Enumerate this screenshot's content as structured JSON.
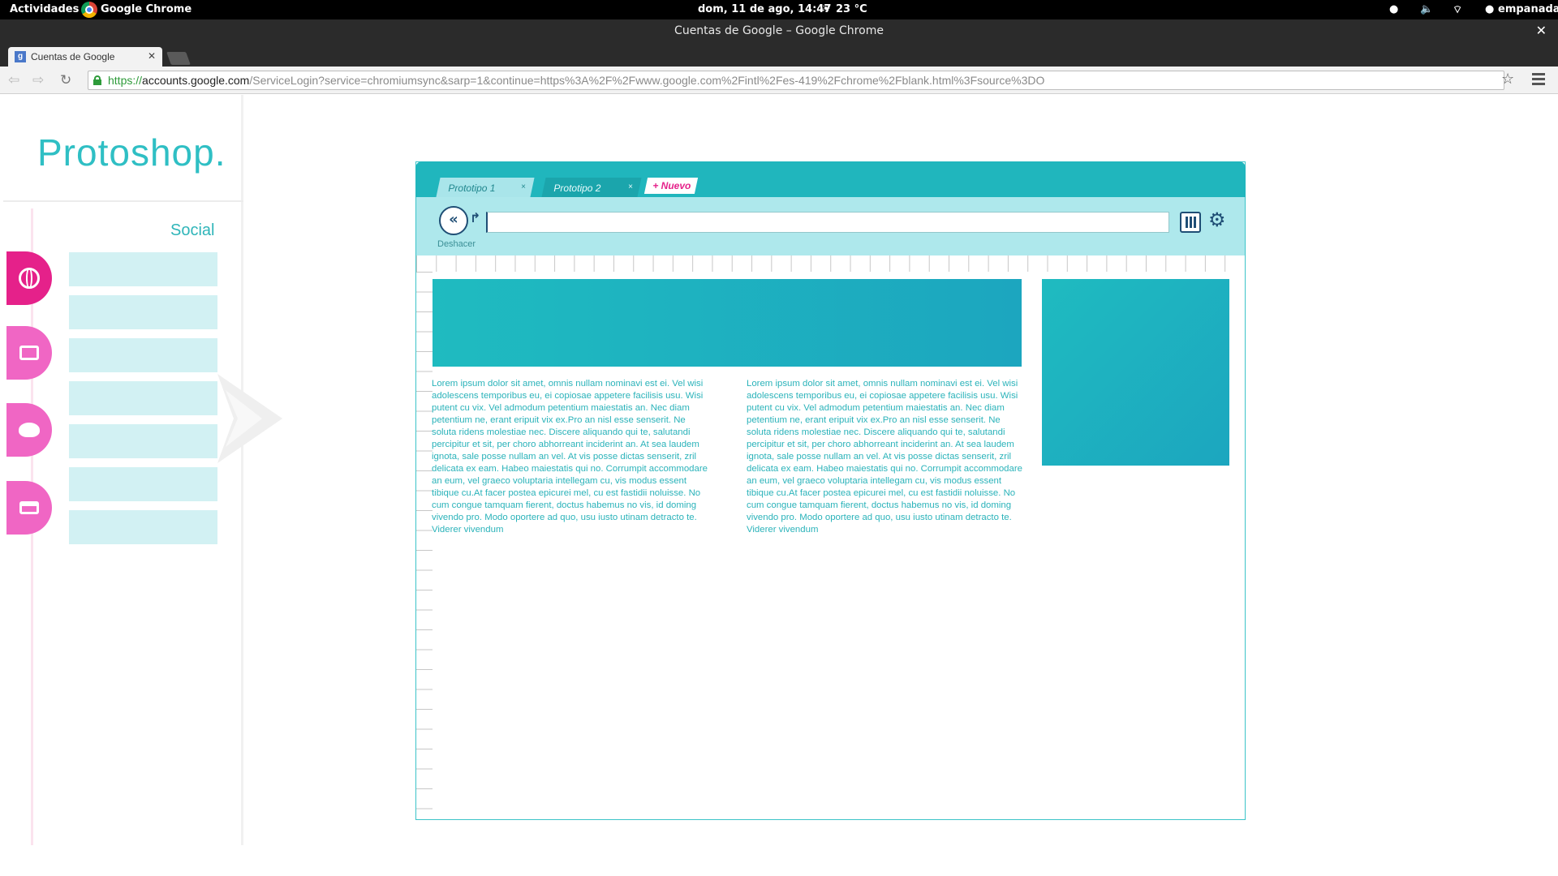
{
  "topbar": {
    "activities": "Actividades",
    "app_name": "Google Chrome",
    "clock": "dom, 11 de ago, 14:47",
    "weather": "23 °C",
    "user": "empanada"
  },
  "window": {
    "title": "Cuentas de Google – Google Chrome"
  },
  "browser": {
    "tab_title": "Cuentas de Google",
    "url_scheme": "https://",
    "url_domain": "accounts.google.com",
    "url_path": "/ServiceLogin?service=chromiumsync&sarp=1&continue=https%3A%2F%2Fwww.google.com%2Fintl%2Fes-419%2Fchrome%2Fblank.html%3Fsource%3DO"
  },
  "sidebar": {
    "brand": "Protoshop.",
    "section": "Social",
    "categories": [
      {
        "name": "globe-icon",
        "color": "#e5218a"
      },
      {
        "name": "photos-icon",
        "color": "#f066c4"
      },
      {
        "name": "palette-icon",
        "color": "#f066c4"
      },
      {
        "name": "card-icon",
        "color": "#f066c4"
      }
    ]
  },
  "app": {
    "tabs": [
      {
        "label": "Prototipo 1",
        "active": true
      },
      {
        "label": "Prototipo 2",
        "active": false
      }
    ],
    "new_tab": "+ Nuevo",
    "undo_label": "Deshacer",
    "colors": {
      "accent": "#20b6bd",
      "bar": "#aee8ec",
      "dark": "#1f4e75",
      "pink": "#e5218a"
    },
    "lorem_col1": "Lorem ipsum dolor sit amet, omnis nullam nominavi est ei. Vel wisi adolescens temporibus eu, ei copiosae appetere facilisis usu. Wisi putent cu vix. Vel admodum petentium maiestatis an. Nec diam petentium ne, erant eripuit vix ex.Pro an nisl esse senserit. Ne soluta ridens molestiae nec. Discere aliquando qui te, salutandi percipitur et sit, per choro abhorreant inciderint an. At sea laudem ignota, sale posse nullam an vel. At vis posse dictas senserit, zril delicata ex eam. Habeo maiestatis qui no. Corrumpit accommodare an eum, vel graeco voluptaria intellegam cu, vis modus essent tibique cu.At facer postea epicurei mel, cu est fastidii noluisse. No cum congue tamquam fierent, doctus habemus no vis, id doming vivendo pro. Modo oportere ad quo, usu iusto utinam detracto te. Viderer vivendum",
    "lorem_col2": "Lorem ipsum dolor sit amet, omnis nullam nominavi est ei. Vel wisi adolescens temporibus eu, ei copiosae appetere facilisis usu. Wisi putent cu vix. Vel admodum petentium maiestatis an. Nec diam petentium ne, erant eripuit vix ex.Pro an nisl esse senserit. Ne soluta ridens molestiae nec. Discere aliquando qui te, salutandi percipitur et sit, per choro abhorreant inciderint an. At sea laudem ignota, sale posse nullam an vel. At vis posse dictas senserit, zril delicata ex eam. Habeo maiestatis qui no. Corrumpit accommodare an eum, vel graeco voluptaria intellegam cu, vis modus essent tibique cu.At facer postea epicurei mel, cu est fastidii noluisse. No cum congue tamquam fierent, doctus habemus no vis, id doming vivendo pro. Modo oportere ad quo, usu iusto utinam detracto te. Viderer vivendum"
  }
}
